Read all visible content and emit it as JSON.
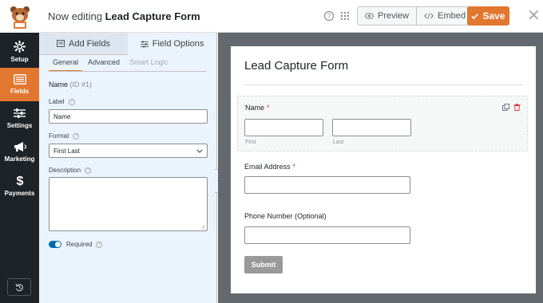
{
  "topbar": {
    "editing_prefix": "Now editing",
    "form_name": "Lead Capture Form",
    "preview_label": "Preview",
    "embed_label": "Embed",
    "save_label": "Save"
  },
  "nav": {
    "items": [
      {
        "label": "Setup",
        "icon": "gear-icon"
      },
      {
        "label": "Fields",
        "icon": "fields-list-icon"
      },
      {
        "label": "Settings",
        "icon": "sliders-icon"
      },
      {
        "label": "Marketing",
        "icon": "megaphone-icon"
      },
      {
        "label": "Payments",
        "icon": "dollar-icon"
      }
    ],
    "active": "Fields"
  },
  "panel": {
    "tabs": [
      "Add Fields",
      "Field Options"
    ],
    "active_tab": "Field Options",
    "subtabs": [
      "General",
      "Advanced",
      "Smart Logic"
    ],
    "field_name": "Name",
    "field_id": "(ID #1)",
    "label_label": "Label",
    "label_value": "Name",
    "format_label": "Format",
    "format_value": "First Last",
    "description_label": "Description",
    "required_label": "Required",
    "required_on": true
  },
  "form": {
    "title": "Lead Capture Form",
    "name_label": "Name",
    "required_mark": "*",
    "first_sub": "First",
    "last_sub": "Last",
    "email_label": "Email Address",
    "phone_label": "Phone Number (Optional)",
    "submit_label": "Submit"
  },
  "colors": {
    "accent": "#e27730",
    "nav_bg": "#1d2327",
    "panel_bg": "#ebf3fc",
    "preview_bg": "#646970",
    "required": "#d63638"
  }
}
